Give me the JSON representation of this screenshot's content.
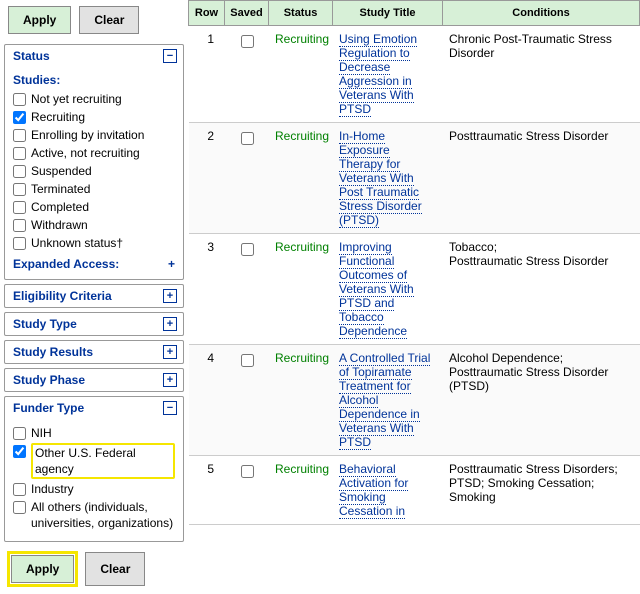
{
  "buttons": {
    "apply": "Apply",
    "clear": "Clear"
  },
  "panels": {
    "status": {
      "title": "Status",
      "open": true,
      "studies_label": "Studies:",
      "items": [
        {
          "label": "Not yet recruiting",
          "checked": false
        },
        {
          "label": "Recruiting",
          "checked": true
        },
        {
          "label": "Enrolling by invitation",
          "checked": false
        },
        {
          "label": "Active, not recruiting",
          "checked": false
        },
        {
          "label": "Suspended",
          "checked": false
        },
        {
          "label": "Terminated",
          "checked": false
        },
        {
          "label": "Completed",
          "checked": false
        },
        {
          "label": "Withdrawn",
          "checked": false
        },
        {
          "label": "Unknown status†",
          "checked": false
        }
      ],
      "expanded_access": "Expanded Access:"
    },
    "eligibility": {
      "title": "Eligibility Criteria",
      "open": false
    },
    "studytype": {
      "title": "Study Type",
      "open": false
    },
    "results": {
      "title": "Study Results",
      "open": false
    },
    "phase": {
      "title": "Study Phase",
      "open": false
    },
    "funder": {
      "title": "Funder Type",
      "open": true,
      "items": [
        {
          "label": "NIH",
          "checked": false,
          "highlight": false
        },
        {
          "label": "Other U.S. Federal agency",
          "checked": true,
          "highlight": true
        },
        {
          "label": "Industry",
          "checked": false,
          "highlight": false
        },
        {
          "label": "All others (individuals, universities, organizations)",
          "checked": false,
          "highlight": false
        }
      ]
    }
  },
  "table": {
    "headers": {
      "row": "Row",
      "saved": "Saved",
      "status": "Status",
      "title": "Study Title",
      "conditions": "Conditions"
    },
    "rows": [
      {
        "n": "1",
        "status": "Recruiting",
        "title": "Using Emotion Regulation to Decrease Aggression in Veterans With PTSD",
        "cond": "Chronic Post-Traumatic Stress Disorder"
      },
      {
        "n": "2",
        "status": "Recruiting",
        "title": "In-Home Exposure Therapy for Veterans With Post Traumatic Stress Disorder (PTSD)",
        "cond": "Posttraumatic Stress Disorder"
      },
      {
        "n": "3",
        "status": "Recruiting",
        "title": "Improving Functional Outcomes of Veterans With PTSD and Tobacco Dependence",
        "cond": "Tobacco;\nPosttraumatic Stress Disorder"
      },
      {
        "n": "4",
        "status": "Recruiting",
        "title": "A Controlled Trial of Topiramate Treatment for Alcohol Dependence in Veterans With PTSD",
        "cond": "Alcohol Dependence;\nPosttraumatic Stress Disorder (PTSD)"
      },
      {
        "n": "5",
        "status": "Recruiting",
        "title": "Behavioral Activation for Smoking Cessation in",
        "cond": "Posttraumatic Stress Disorders;\nPTSD;   Smoking Cessation;   Smoking"
      }
    ]
  }
}
